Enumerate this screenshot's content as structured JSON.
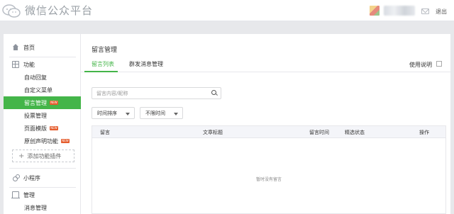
{
  "header": {
    "brand": "微信公众平台",
    "logout": "退出"
  },
  "sidebar": {
    "home": "首页",
    "features_section": "功能",
    "feature_items": [
      {
        "label": "自动回复",
        "new": false
      },
      {
        "label": "自定义菜单",
        "new": false
      },
      {
        "label": "留言管理",
        "new": true,
        "active": true
      },
      {
        "label": "投票管理",
        "new": false
      },
      {
        "label": "页面模版",
        "new": true
      },
      {
        "label": "原创声明功能",
        "new": true
      }
    ],
    "new_badge": "NEW",
    "add_plugin": "添加功能插件",
    "mini_program": "小程序",
    "manage_section": "管理",
    "manage_items": [
      "消息管理"
    ]
  },
  "main": {
    "title": "留言管理",
    "tabs": [
      "留言列表",
      "群发消息管理"
    ],
    "help": "使用说明",
    "search": {
      "placeholder": "留言内容/昵称"
    },
    "sort_dropdown": "时间排序",
    "time_dropdown": "不限时间",
    "table": {
      "columns": [
        "留言",
        "文章标题",
        "留言时间",
        "精选状态",
        "操作"
      ],
      "empty_text": "暂时没有留言"
    }
  },
  "colors": {
    "accent": "#44b549",
    "new_badge": "#e55d2e",
    "page_bg": "#e7e8eb"
  }
}
